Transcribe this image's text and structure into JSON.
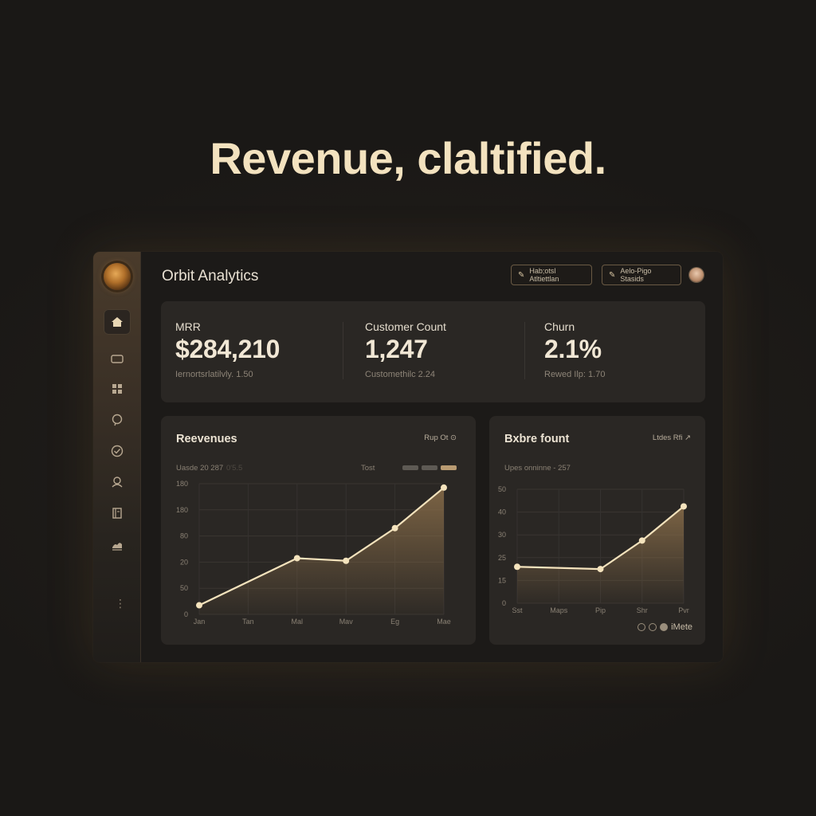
{
  "headline": "Revenue, claltified.",
  "app": {
    "title": "Orbit Analytics",
    "top_actions": [
      {
        "label": "Hab;otsl Atltiettlan",
        "icon": "spark-icon"
      },
      {
        "label": "Aelo-Pigo Stasids",
        "icon": "spark-icon"
      }
    ],
    "sidebar": {
      "items": [
        {
          "name": "home",
          "icon": "home-icon",
          "active": true
        },
        {
          "name": "cards",
          "icon": "card-icon"
        },
        {
          "name": "grid",
          "icon": "grid-icon"
        },
        {
          "name": "chat",
          "icon": "chat-bubble-icon"
        },
        {
          "name": "shield",
          "icon": "shield-icon"
        },
        {
          "name": "users",
          "icon": "users-icon"
        },
        {
          "name": "reports",
          "icon": "book-icon"
        },
        {
          "name": "analytics",
          "icon": "chart-stack-icon"
        }
      ],
      "more_glyph": "⋮"
    },
    "kpis": [
      {
        "label": "MRR",
        "value": "$284,210",
        "sub": "Iernortsrlatilvly. 1.50"
      },
      {
        "label": "Customer Count",
        "value": "1,247",
        "sub": "Customethilc 2.24"
      },
      {
        "label": "Churn",
        "value": "2.1%",
        "sub": "Rewed Ilp: 1.70"
      }
    ]
  },
  "chart_data": [
    {
      "type": "area",
      "title": "Reevenues",
      "controls": "Rup  Ot ⊙",
      "meta_left": "Uasde 20 287",
      "meta_faint": "0'5.5",
      "meta_right": "Tost",
      "legend_colors": [
        "#5e5a54",
        "#5e5a54",
        "#b99b72"
      ],
      "x": [
        "Jan",
        "Tan",
        "Mal",
        "Mav",
        "Eg",
        "Mae"
      ],
      "y_tick_labels": [
        "0",
        "50",
        "20",
        "80",
        "180",
        "180"
      ],
      "values": [
        7,
        43,
        41,
        66,
        97
      ],
      "x_positions": [
        0,
        2,
        3,
        4,
        5
      ],
      "ylim": [
        0,
        100
      ],
      "line_color": "#f4e3bd",
      "fill_color": "#8a6e4a"
    },
    {
      "type": "area",
      "title": "Bxbre fount",
      "controls": "Ltdes  Rfi  ↗",
      "meta_left": "Upes onninne - 257",
      "x": [
        "Sst",
        "Maps",
        "Pip",
        "Shr",
        "Pvr"
      ],
      "y_tick_labels": [
        "0",
        "15",
        "25",
        "30",
        "40",
        "50"
      ],
      "values": [
        32,
        30,
        55,
        85
      ],
      "x_positions": [
        0,
        2,
        3,
        4
      ],
      "ylim": [
        0,
        100
      ],
      "footer_label": "iMete",
      "line_color": "#f4e3bd",
      "fill_color": "#8a6e4a"
    }
  ]
}
